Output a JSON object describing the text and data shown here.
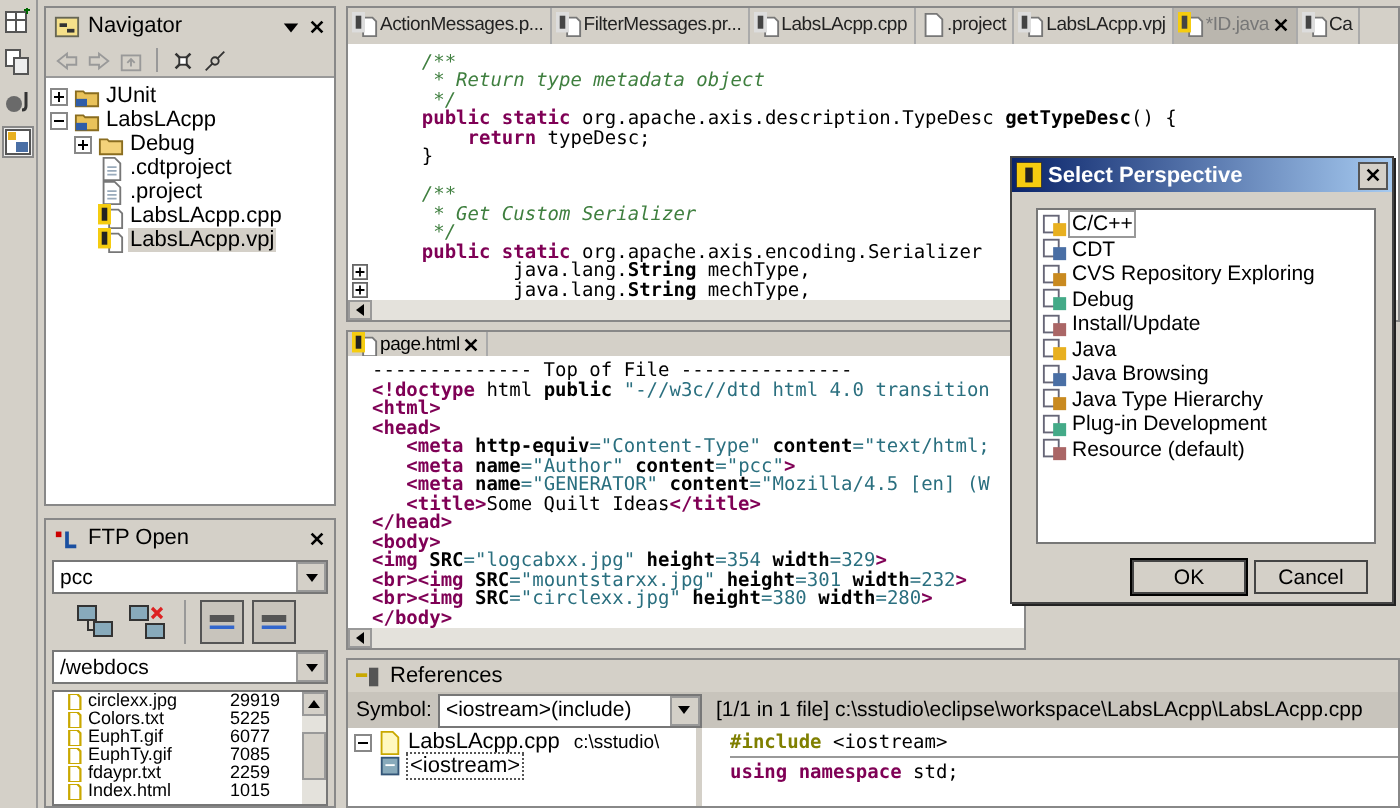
{
  "navigator": {
    "title": "Navigator",
    "tree": [
      {
        "label": "JUnit",
        "kind": "project",
        "expanded": false,
        "selected": false
      },
      {
        "label": "LabsLAcpp",
        "kind": "project",
        "expanded": true,
        "selected": false,
        "children": [
          {
            "label": "Debug",
            "kind": "folder",
            "expanded": false,
            "selected": false
          },
          {
            "label": ".cdtproject",
            "kind": "file",
            "selected": false
          },
          {
            "label": ".project",
            "kind": "file",
            "selected": false
          },
          {
            "label": "LabsLAcpp.cpp",
            "kind": "source",
            "selected": false
          },
          {
            "label": "LabsLAcpp.vpj",
            "kind": "source",
            "selected": true
          }
        ]
      }
    ]
  },
  "ftp": {
    "title": "FTP Open",
    "host": "pcc",
    "path": "/webdocs",
    "files": [
      {
        "name": "circlexx.jpg",
        "size": "29919"
      },
      {
        "name": "Colors.txt",
        "size": "5225"
      },
      {
        "name": "EuphT.gif",
        "size": "6077"
      },
      {
        "name": "EuphTy.gif",
        "size": "7085"
      },
      {
        "name": "fdaypr.txt",
        "size": "2259"
      },
      {
        "name": "Index.html",
        "size": "1015"
      }
    ]
  },
  "editor": {
    "tabs": [
      {
        "label": "ActionMessages.p...",
        "kind": "source",
        "selected": false
      },
      {
        "label": "FilterMessages.pr...",
        "kind": "source",
        "selected": false
      },
      {
        "label": "LabsLAcpp.cpp",
        "kind": "source",
        "selected": false
      },
      {
        "label": ".project",
        "kind": "file",
        "selected": false
      },
      {
        "label": "LabsLAcpp.vpj",
        "kind": "source",
        "selected": false
      },
      {
        "label": "*ID.java",
        "kind": "source",
        "selected": true
      },
      {
        "label": "Ca",
        "kind": "source",
        "selected": false
      }
    ],
    "lines": [
      {
        "fold": false,
        "segments": [
          {
            "kind": "comment",
            "t": "    /**"
          }
        ]
      },
      {
        "fold": false,
        "segments": [
          {
            "kind": "comment",
            "t": "     * Return type metadata object"
          }
        ]
      },
      {
        "fold": false,
        "segments": [
          {
            "kind": "comment",
            "t": "     */"
          }
        ]
      },
      {
        "fold": false,
        "segments": [
          {
            "kind": "keyword",
            "t": "    public static"
          },
          {
            "kind": "plain",
            "t": " org.apache.axis.description.TypeDesc "
          },
          {
            "kind": "bold",
            "t": "getTypeDesc"
          },
          {
            "kind": "plain",
            "t": "() {"
          }
        ]
      },
      {
        "fold": false,
        "segments": [
          {
            "kind": "keyword",
            "t": "        return"
          },
          {
            "kind": "plain",
            "t": " typeDesc;"
          }
        ]
      },
      {
        "fold": false,
        "segments": [
          {
            "kind": "plain",
            "t": "    }"
          }
        ]
      },
      {
        "fold": false
      },
      {
        "fold": false,
        "segments": [
          {
            "kind": "comment",
            "t": "    /**"
          }
        ]
      },
      {
        "fold": false,
        "segments": [
          {
            "kind": "comment",
            "t": "     * Get Custom Serializer"
          }
        ]
      },
      {
        "fold": false,
        "segments": [
          {
            "kind": "comment",
            "t": "     */"
          }
        ]
      },
      {
        "fold": false,
        "segments": [
          {
            "kind": "keyword",
            "t": "    public static"
          },
          {
            "kind": "plain",
            "t": " org.apache.axis.encoding.Serializer"
          }
        ]
      },
      {
        "fold": true,
        "segments": [
          {
            "kind": "plain",
            "t": "            java.lang."
          },
          {
            "kind": "bold",
            "t": "String"
          },
          {
            "kind": "plain",
            "t": " mechType,"
          }
        ]
      },
      {
        "fold": true,
        "segments": [
          {
            "kind": "plain",
            "t": "            java.lang."
          },
          {
            "kind": "bold",
            "t": "String"
          },
          {
            "kind": "plain",
            "t": " mechType,"
          }
        ]
      }
    ]
  },
  "page_editor": {
    "tab": "page.html",
    "lines": [
      {
        "segments": [
          {
            "kind": "plain",
            "t": "-------------- Top of File ---------------"
          }
        ]
      },
      {
        "segments": [
          {
            "kind": "tag",
            "t": "<!doctype"
          },
          {
            "kind": "plain",
            "t": " html "
          },
          {
            "kind": "bold",
            "t": "public"
          },
          {
            "kind": "string",
            "t": " \"-//w3c//dtd html 4.0 transition"
          }
        ]
      },
      {
        "segments": [
          {
            "kind": "tag",
            "t": "<html>"
          }
        ]
      },
      {
        "segments": [
          {
            "kind": "tag",
            "t": "<head>"
          }
        ]
      },
      {
        "segments": [
          {
            "kind": "tag",
            "t": "   <meta"
          },
          {
            "kind": "bold",
            "t": " http-equiv"
          },
          {
            "kind": "string",
            "t": "=\"Content-Type\""
          },
          {
            "kind": "bold",
            "t": " content"
          },
          {
            "kind": "string",
            "t": "=\"text/html;"
          }
        ]
      },
      {
        "segments": [
          {
            "kind": "tag",
            "t": "   <meta"
          },
          {
            "kind": "bold",
            "t": " name"
          },
          {
            "kind": "string",
            "t": "=\"Author\""
          },
          {
            "kind": "bold",
            "t": " content"
          },
          {
            "kind": "string",
            "t": "=\"pcc\""
          },
          {
            "kind": "tag",
            "t": ">"
          }
        ]
      },
      {
        "segments": [
          {
            "kind": "tag",
            "t": "   <meta"
          },
          {
            "kind": "bold",
            "t": " name"
          },
          {
            "kind": "string",
            "t": "=\"GENERATOR\""
          },
          {
            "kind": "bold",
            "t": " content"
          },
          {
            "kind": "string",
            "t": "=\"Mozilla/4.5 [en] (W"
          }
        ]
      },
      {
        "segments": [
          {
            "kind": "tag",
            "t": "   <title>"
          },
          {
            "kind": "plain",
            "t": "Some Quilt Ideas"
          },
          {
            "kind": "tag",
            "t": "</title>"
          }
        ]
      },
      {
        "segments": [
          {
            "kind": "tag",
            "t": "</head>"
          }
        ]
      },
      {
        "segments": [
          {
            "kind": "tag",
            "t": "<body>"
          }
        ]
      },
      {
        "segments": [
          {
            "kind": "tag",
            "t": "<img"
          },
          {
            "kind": "bold",
            "t": " SRC"
          },
          {
            "kind": "string",
            "t": "=\"logcabxx.jpg\""
          },
          {
            "kind": "bold",
            "t": " height"
          },
          {
            "kind": "string",
            "t": "=354"
          },
          {
            "kind": "bold",
            "t": " width"
          },
          {
            "kind": "string",
            "t": "=329"
          },
          {
            "kind": "tag",
            "t": ">"
          }
        ]
      },
      {
        "segments": [
          {
            "kind": "tag",
            "t": "<br><img"
          },
          {
            "kind": "bold",
            "t": " SRC"
          },
          {
            "kind": "string",
            "t": "=\"mountstarxx.jpg\""
          },
          {
            "kind": "bold",
            "t": " height"
          },
          {
            "kind": "string",
            "t": "=301"
          },
          {
            "kind": "bold",
            "t": " width"
          },
          {
            "kind": "string",
            "t": "=232"
          },
          {
            "kind": "tag",
            "t": ">"
          }
        ]
      },
      {
        "segments": [
          {
            "kind": "tag",
            "t": "<br><img"
          },
          {
            "kind": "bold",
            "t": " SRC"
          },
          {
            "kind": "string",
            "t": "=\"circlexx.jpg\""
          },
          {
            "kind": "bold",
            "t": " height"
          },
          {
            "kind": "string",
            "t": "=380"
          },
          {
            "kind": "bold",
            "t": " width"
          },
          {
            "kind": "string",
            "t": "=280"
          },
          {
            "kind": "tag",
            "t": ">"
          }
        ]
      },
      {
        "segments": [
          {
            "kind": "tag",
            "t": "</body>"
          }
        ]
      }
    ]
  },
  "references": {
    "title": "References",
    "symbol_label": "Symbol:",
    "symbol": "<iostream>(include)",
    "info": "[1/1 in 1 file] c:\\sstudio\\eclipse\\workspace\\LabsLAcpp\\LabsLAcpp.cpp",
    "tree": [
      {
        "label": "LabsLAcpp.cpp",
        "path": "c:\\sstudio\\",
        "expanded": true,
        "selected": false,
        "children": [
          {
            "label": "<iostream>",
            "selected": true
          }
        ]
      }
    ],
    "lines": [
      {
        "segments": [
          {
            "kind": "directive",
            "t": "#include"
          },
          {
            "kind": "plain",
            "t": " <iostream>"
          }
        ]
      },
      {
        "segments": [
          {
            "kind": "keyword",
            "t": "using namespace"
          },
          {
            "kind": "plain",
            "t": " std;"
          }
        ]
      }
    ]
  },
  "dialog": {
    "title": "Select Perspective",
    "items": [
      {
        "label": "C/C++",
        "selected": true
      },
      {
        "label": "CDT",
        "selected": false
      },
      {
        "label": "CVS Repository Exploring",
        "selected": false
      },
      {
        "label": "Debug",
        "selected": false
      },
      {
        "label": "Install/Update",
        "selected": false
      },
      {
        "label": "Java",
        "selected": false
      },
      {
        "label": "Java Browsing",
        "selected": false
      },
      {
        "label": "Java Type Hierarchy",
        "selected": false
      },
      {
        "label": "Plug-in Development",
        "selected": false
      },
      {
        "label": "Resource (default)",
        "selected": false
      }
    ],
    "buttons": [
      "OK",
      "Cancel"
    ]
  }
}
